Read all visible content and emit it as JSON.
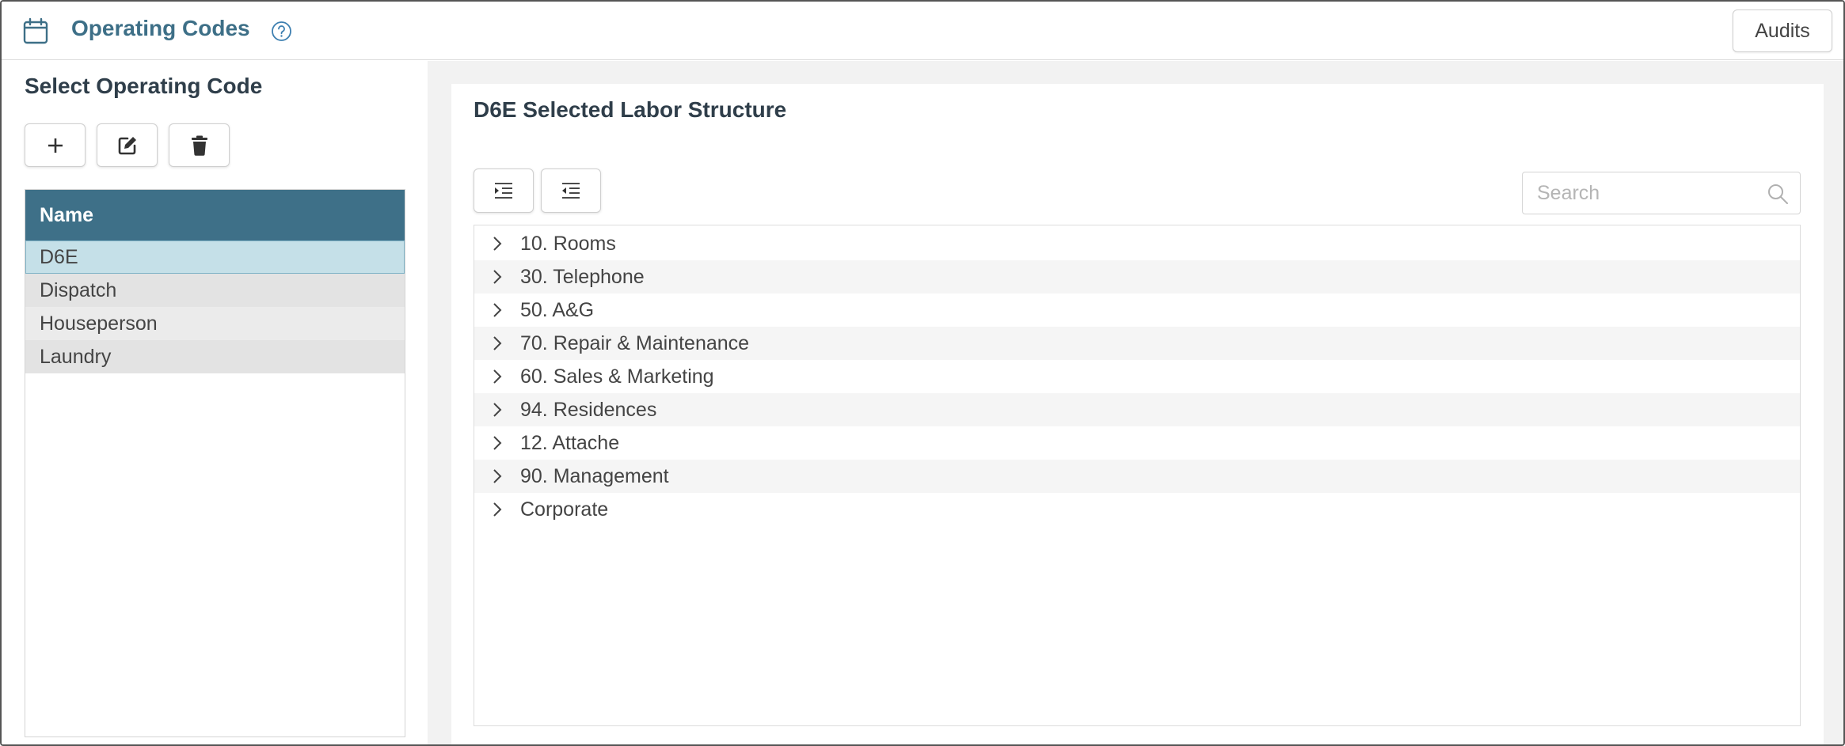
{
  "header": {
    "title": "Operating Codes",
    "audits_label": "Audits"
  },
  "left": {
    "section_title": "Select Operating Code",
    "grid": {
      "column_header": "Name",
      "rows": [
        "D6E",
        "Dispatch",
        "Houseperson",
        "Laundry"
      ],
      "selected": "D6E"
    }
  },
  "right": {
    "card_title": "D6E Selected Labor Structure",
    "search": {
      "placeholder": "Search",
      "value": ""
    },
    "tree": [
      "10. Rooms",
      "30. Telephone",
      "50. A&G",
      "70. Repair & Maintenance",
      "60. Sales & Marketing",
      "94. Residences",
      "12. Attache",
      "90. Management",
      "Corporate"
    ]
  },
  "colors": {
    "accent": "#3d6f87",
    "grid_header_bg": "#3e7088",
    "selected_row_bg": "#c5e0e8"
  },
  "icons": {
    "header": "calendar-icon",
    "help": "question-circle-icon",
    "add": "plus-icon",
    "edit": "edit-icon",
    "delete": "trash-icon",
    "expand_all": "indent-icon",
    "collapse_all": "outdent-icon",
    "search": "search-icon",
    "tree_toggle": "chevron-right-icon"
  }
}
